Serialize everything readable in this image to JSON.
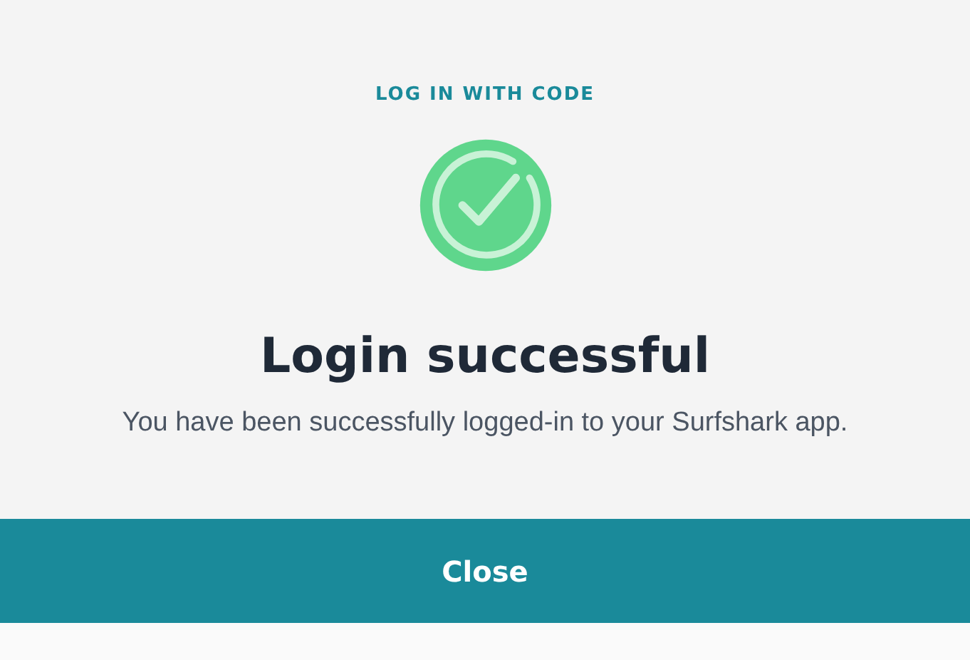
{
  "header": {
    "label": "LOG IN WITH CODE"
  },
  "title": "Login successful",
  "message": "You have been successfully logged-in to your Surfshark app.",
  "buttons": [
    {
      "label": "Close",
      "kind": "primary"
    }
  ]
}
